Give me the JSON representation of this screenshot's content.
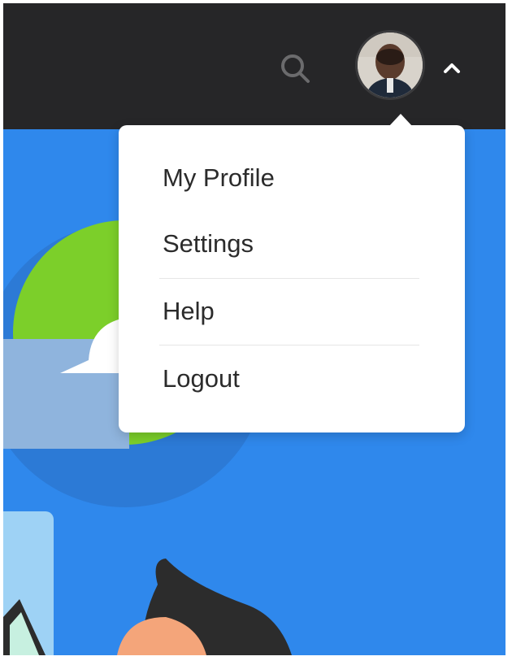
{
  "topbar": {
    "search_icon": "search-icon",
    "avatar_icon": "user-avatar",
    "chevron_icon": "chevron-up-icon",
    "background": "#262628"
  },
  "menu": {
    "items": [
      {
        "label": "My Profile"
      },
      {
        "label": "Settings"
      },
      {
        "label": "Help"
      },
      {
        "label": "Logout"
      }
    ]
  },
  "colors": {
    "accent_blue": "#2f88ec",
    "green_badge": "#7ccf2a",
    "menu_text": "#2b2b2b"
  }
}
